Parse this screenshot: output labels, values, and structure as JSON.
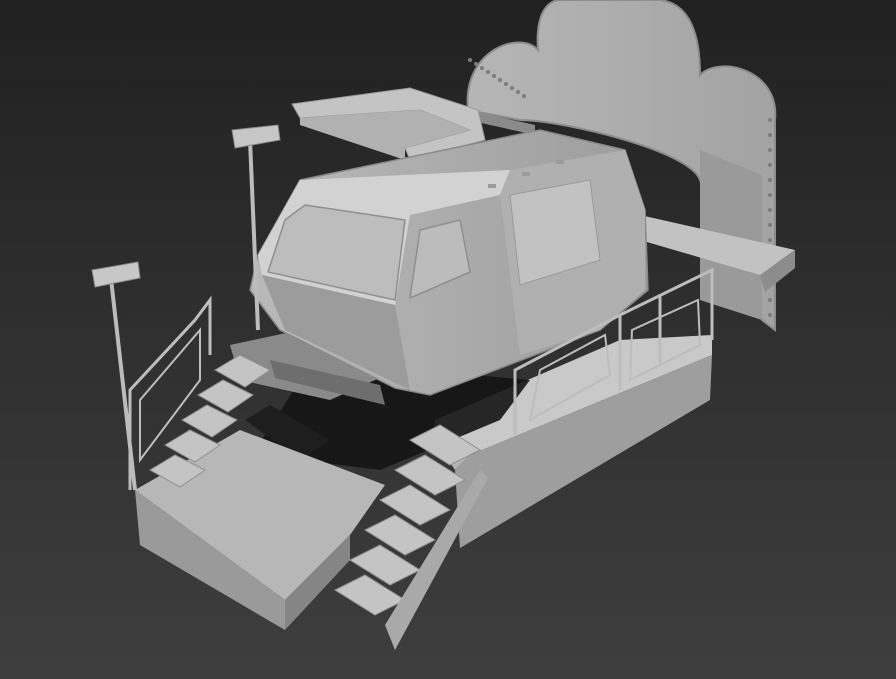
{
  "scene": {
    "background_top": "#212121",
    "background_bottom": "#3e3e3e",
    "model_light": "#cfcfcf",
    "model_mid": "#a9a9a9",
    "model_dark": "#7c7c7c",
    "model_shadow": "#141414"
  }
}
